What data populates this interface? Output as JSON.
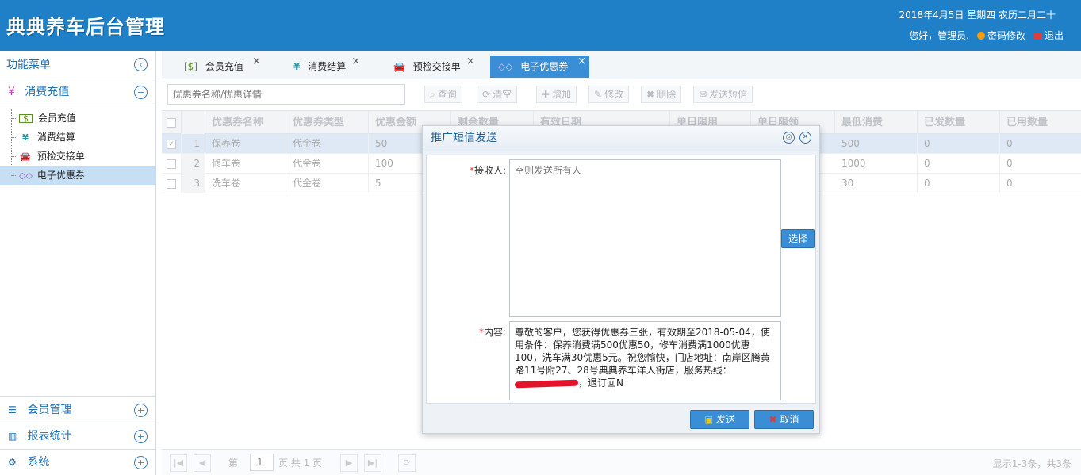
{
  "header": {
    "logo": "典典养车后台管理",
    "date": "2018年4月5日 星期四 农历二月二十",
    "greeting": "您好，管理员.",
    "change_password": "密码修改",
    "logout": "退出"
  },
  "sidebar": {
    "title": "功能菜单",
    "group": "消费充值",
    "items": [
      {
        "label": "会员充值"
      },
      {
        "label": "消费结算"
      },
      {
        "label": "预检交接单"
      },
      {
        "label": "电子优惠券"
      }
    ],
    "bottom": [
      "会员管理",
      "报表统计",
      "系统"
    ]
  },
  "tabs": [
    "会员充值",
    "消费结算",
    "预检交接单",
    "电子优惠券"
  ],
  "toolbar": {
    "search_placeholder": "优惠券名称/优惠详情",
    "query": "查询",
    "clear": "清空",
    "add": "增加",
    "edit": "修改",
    "delete": "删除",
    "sms": "发送短信"
  },
  "grid": {
    "headers": [
      "优惠券名称",
      "优惠券类型",
      "优惠金额",
      "剩余数量",
      "有效日期",
      "单日限用",
      "单日限领",
      "最低消费",
      "已发数量",
      "已用数量"
    ],
    "rows": [
      {
        "no": "1",
        "name": "保养卷",
        "type": "代金卷",
        "amount": "50",
        "min": "500",
        "issued": "0",
        "used": "0"
      },
      {
        "no": "2",
        "name": "修车卷",
        "type": "代金卷",
        "amount": "100",
        "min": "1000",
        "issued": "0",
        "used": "0"
      },
      {
        "no": "3",
        "name": "洗车卷",
        "type": "代金卷",
        "amount": "5",
        "min": "30",
        "issued": "0",
        "used": "0"
      }
    ]
  },
  "pager": {
    "page_prefix": "第",
    "page": "1",
    "page_suffix": "页,共 1 页",
    "info": "显示1-3条，共3条"
  },
  "dialog": {
    "title": "推广短信发送",
    "recipient_label": "接收人:",
    "recipient_placeholder": "空则发送所有人",
    "select": "选择",
    "content_label": "内容:",
    "content_part1": "尊敬的客户，您获得优惠券三张，有效期至2018-05-04，使用条件：保养消费满500优惠50，修车消费满1000优惠100，洗车满30优惠5元。祝您愉快，门店地址：南岸区腾黄路11号附27、28号典典养车洋人街店，服务热线：",
    "content_part2": "，退订回N",
    "send": "发送",
    "cancel": "取消"
  },
  "colors": {
    "header_bg": "#1f80c7",
    "accent": "#3a8ed6"
  }
}
